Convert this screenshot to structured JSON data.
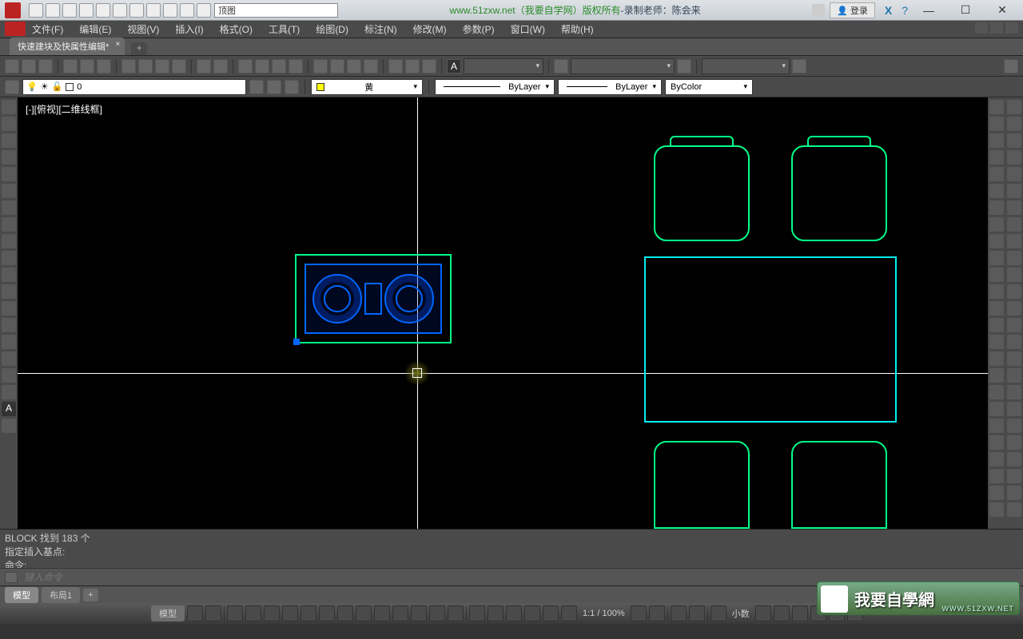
{
  "titlebar": {
    "view_field": "顶图",
    "center_green": "www.51zxw.net（我要自学网）版权所有",
    "center_rest": "-录制老师：陈会来",
    "login": "登录"
  },
  "menus": [
    "文件(F)",
    "编辑(E)",
    "视图(V)",
    "插入(I)",
    "格式(O)",
    "工具(T)",
    "绘图(D)",
    "标注(N)",
    "修改(M)",
    "参数(P)",
    "窗口(W)",
    "帮助(H)"
  ],
  "doc_tab": "快速建块及快属性编辑*",
  "layer": {
    "name": "0",
    "color_label": "黄",
    "linetype": "ByLayer",
    "lineweight": "ByLayer",
    "plotstyle": "ByColor"
  },
  "viewport_label": "[-][俯视][二维线框]",
  "cmd": {
    "line1": "BLOCK 找到 183 个",
    "line2": "指定插入基点:",
    "line3": "命令:",
    "placeholder": "键入命令"
  },
  "bottom_tabs": {
    "model": "模型",
    "layout1": "布局1"
  },
  "status": {
    "model_btn": "模型",
    "scale": "1:1 / 100%",
    "precision": "小数"
  },
  "watermark": {
    "main": "我要自學網",
    "sub": "WWW.51ZXW.NET"
  }
}
